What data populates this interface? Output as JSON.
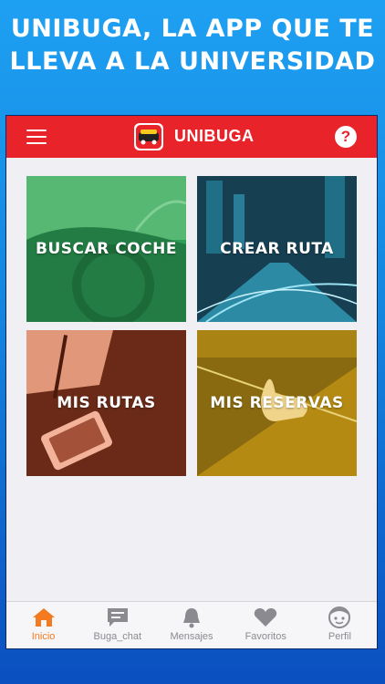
{
  "promo": {
    "line1": "UNIBUGA, LA APP QUE TE",
    "line2": "LLEVA A LA UNIVERSIDAD"
  },
  "appbar": {
    "title": "UNIBUGA",
    "menu_icon": "hamburger-menu-icon",
    "help_icon": "help-icon",
    "help_glyph": "?",
    "color": "#e8232a"
  },
  "tiles": [
    {
      "label": "BUSCAR COCHE",
      "color": "#2f9e57"
    },
    {
      "label": "CREAR RUTA",
      "color": "#1f6f86"
    },
    {
      "label": "MIS RUTAS",
      "color": "#8a3b22"
    },
    {
      "label": "MIS RESERVAS",
      "color": "#b58a12"
    }
  ],
  "tabbar": {
    "items": [
      {
        "label": "Inicio",
        "icon": "home-icon",
        "active": true
      },
      {
        "label": "Buga_chat",
        "icon": "chat-icon",
        "active": false
      },
      {
        "label": "Mensajes",
        "icon": "bell-icon",
        "active": false
      },
      {
        "label": "Favoritos",
        "icon": "heart-icon",
        "active": false
      },
      {
        "label": "Perfil",
        "icon": "face-icon",
        "active": false
      }
    ],
    "active_color": "#f47a1f",
    "inactive_color": "#8a8a90"
  }
}
